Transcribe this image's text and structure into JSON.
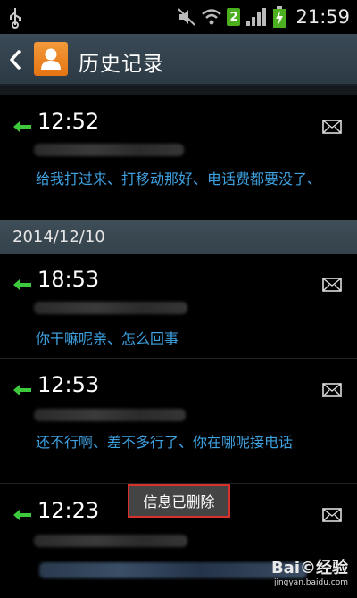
{
  "status_bar": {
    "time": "21:59",
    "badge": "2",
    "icons": [
      "usb-icon",
      "mute-icon",
      "wifi-icon",
      "signal-icon",
      "battery-charging-icon"
    ]
  },
  "action_bar": {
    "title": "历史记录",
    "back_icon": "back-arrow-icon",
    "avatar_icon": "contact-avatar-icon"
  },
  "date_header": "2014/12/10",
  "messages": [
    {
      "time": "12:52",
      "text": "给我打过来、打移动那好、电话费都要没了、",
      "direction": "incoming",
      "icon": "envelope-icon"
    },
    {
      "time": "18:53",
      "text": "你干嘛呢亲、怎么回事",
      "direction": "incoming",
      "icon": "envelope-icon"
    },
    {
      "time": "12:53",
      "text": "还不行啊、差不多行了、你在哪呢接电话",
      "direction": "incoming",
      "icon": "envelope-icon"
    },
    {
      "time": "12:23",
      "text": "",
      "direction": "incoming",
      "icon": "envelope-icon"
    }
  ],
  "toast": "信息已删除",
  "watermark": {
    "logo": "Bai©经验",
    "url": "jingyan.baidu.com"
  },
  "colors": {
    "accent_text": "#3ea1e0",
    "arrow_green": "#3cc93c",
    "toast_border": "#d8302a",
    "header_bg": "#34424b"
  }
}
